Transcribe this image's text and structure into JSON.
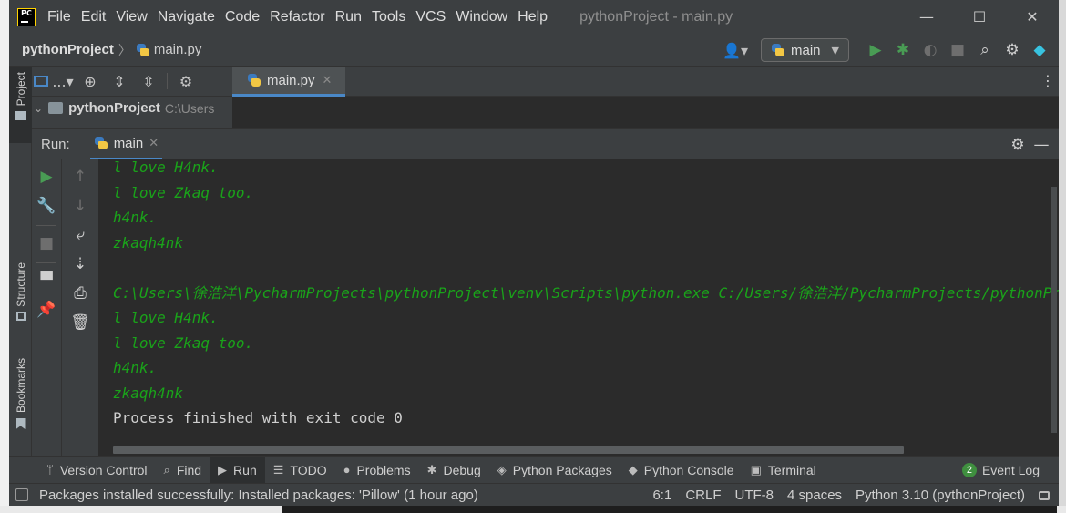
{
  "menu": {
    "app_logo_text": "PC",
    "items": [
      "File",
      "Edit",
      "View",
      "Navigate",
      "Code",
      "Refactor",
      "Run",
      "Tools",
      "VCS",
      "Window",
      "Help"
    ],
    "window_title": "pythonProject - main.py"
  },
  "window_controls": {
    "minimize": "—",
    "maximize": "☐",
    "close": "✕"
  },
  "navbar": {
    "project": "pythonProject",
    "file": "main.py",
    "run_config": "main"
  },
  "left_strip": {
    "project": "Project",
    "structure": "Structure",
    "bookmarks": "Bookmarks"
  },
  "project_panel": {
    "collapse_label": "...",
    "root_name": "pythonProject",
    "root_path": "C:\\Users"
  },
  "editor": {
    "tab_label": "main.py",
    "tab_close": "✕",
    "more": "⋮"
  },
  "run_panel": {
    "label": "Run:",
    "tab_label": "main",
    "tab_close": "✕",
    "console_lines": [
      {
        "text": "l love H4nk.",
        "style": "out"
      },
      {
        "text": "l love Zkaq too.",
        "style": "out"
      },
      {
        "text": "h4nk.",
        "style": "out"
      },
      {
        "text": "zkaqh4nk",
        "style": "out"
      },
      {
        "text": "",
        "style": "out"
      },
      {
        "text": "C:\\Users\\徐浩洋\\PycharmProjects\\pythonProject\\venv\\Scripts\\python.exe C:/Users/徐浩洋/PycharmProjects/pythonProject/main.py",
        "style": "out"
      },
      {
        "text": "l love H4nk.",
        "style": "out"
      },
      {
        "text": "l love Zkaq too.",
        "style": "out"
      },
      {
        "text": "h4nk.",
        "style": "out"
      },
      {
        "text": "zkaqh4nk",
        "style": "out"
      },
      {
        "text": "Process finished with exit code 0",
        "style": "plain"
      }
    ]
  },
  "tool_windows": [
    {
      "label": "Version Control",
      "icon": "branch-icon",
      "glyph": "ᛘ",
      "active": false
    },
    {
      "label": "Find",
      "icon": "search-icon",
      "glyph": "⌕",
      "active": false
    },
    {
      "label": "Run",
      "icon": "play-icon",
      "glyph": "▶",
      "active": true
    },
    {
      "label": "TODO",
      "icon": "list-icon",
      "glyph": "☰",
      "active": false
    },
    {
      "label": "Problems",
      "icon": "info-icon",
      "glyph": "●",
      "active": false
    },
    {
      "label": "Debug",
      "icon": "bug-icon",
      "glyph": "✱",
      "active": false
    },
    {
      "label": "Python Packages",
      "icon": "layers-icon",
      "glyph": "◈",
      "active": false
    },
    {
      "label": "Python Console",
      "icon": "python-icon",
      "glyph": "◆",
      "active": false
    },
    {
      "label": "Terminal",
      "icon": "terminal-icon",
      "glyph": "▣",
      "active": false
    }
  ],
  "event_log": {
    "badge": "2",
    "label": "Event Log"
  },
  "status": {
    "message": "Packages installed successfully: Installed packages: 'Pillow' (1 hour ago)",
    "position": "6:1",
    "line_sep": "CRLF",
    "encoding": "UTF-8",
    "indent": "4 spaces",
    "interpreter": "Python 3.10 (pythonProject)"
  },
  "colors": {
    "accent": "#4a88c7",
    "console_output": "#1aa31a",
    "run_green": "#499c54"
  }
}
